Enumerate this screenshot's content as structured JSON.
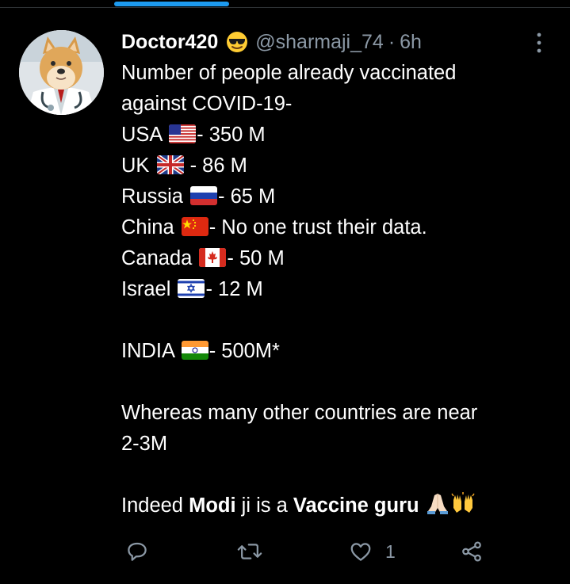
{
  "tweet": {
    "display_name": "Doctor420",
    "name_emoji": "smiling-face-with-sunglasses",
    "handle": "@sharmaji_74",
    "separator": "·",
    "time": "6h",
    "lines": [
      {
        "text": "Number of people already vaccinated"
      },
      {
        "text": "against COVID-19-"
      },
      {
        "before": "USA ",
        "flag": "us",
        "after": "- 350 M"
      },
      {
        "before": "UK ",
        "flag": "uk",
        "after": " - 86 M"
      },
      {
        "before": "Russia ",
        "flag": "ru",
        "after": "-  65 M"
      },
      {
        "before": "China ",
        "flag": "cn",
        "after": "- No one trust their data."
      },
      {
        "before": "Canada ",
        "flag": "ca",
        "after": "- 50 M"
      },
      {
        "before": "Israel ",
        "flag": "il",
        "after": "- 12 M"
      },
      {
        "blank": true
      },
      {
        "before": "INDIA ",
        "flag": "in",
        "after": "- 500M*"
      },
      {
        "blank": true
      },
      {
        "text": "Whereas many other countries are near"
      },
      {
        "text": "2-3M"
      },
      {
        "blank": true
      }
    ],
    "final_line": {
      "part1": "Indeed ",
      "bold1": "Modi",
      "part2": " ji is a ",
      "bold2": "Vaccine guru",
      "emojis": [
        "folded-hands",
        "raising-hands"
      ]
    }
  },
  "actions": {
    "reply_icon": "reply-icon",
    "retweet_icon": "retweet-icon",
    "like_icon": "heart-icon",
    "like_count": "1",
    "share_icon": "share-icon"
  },
  "colors": {
    "background": "#000000",
    "text": "#ffffff",
    "muted": "#8b98a5",
    "accent": "#1d9bf0"
  }
}
